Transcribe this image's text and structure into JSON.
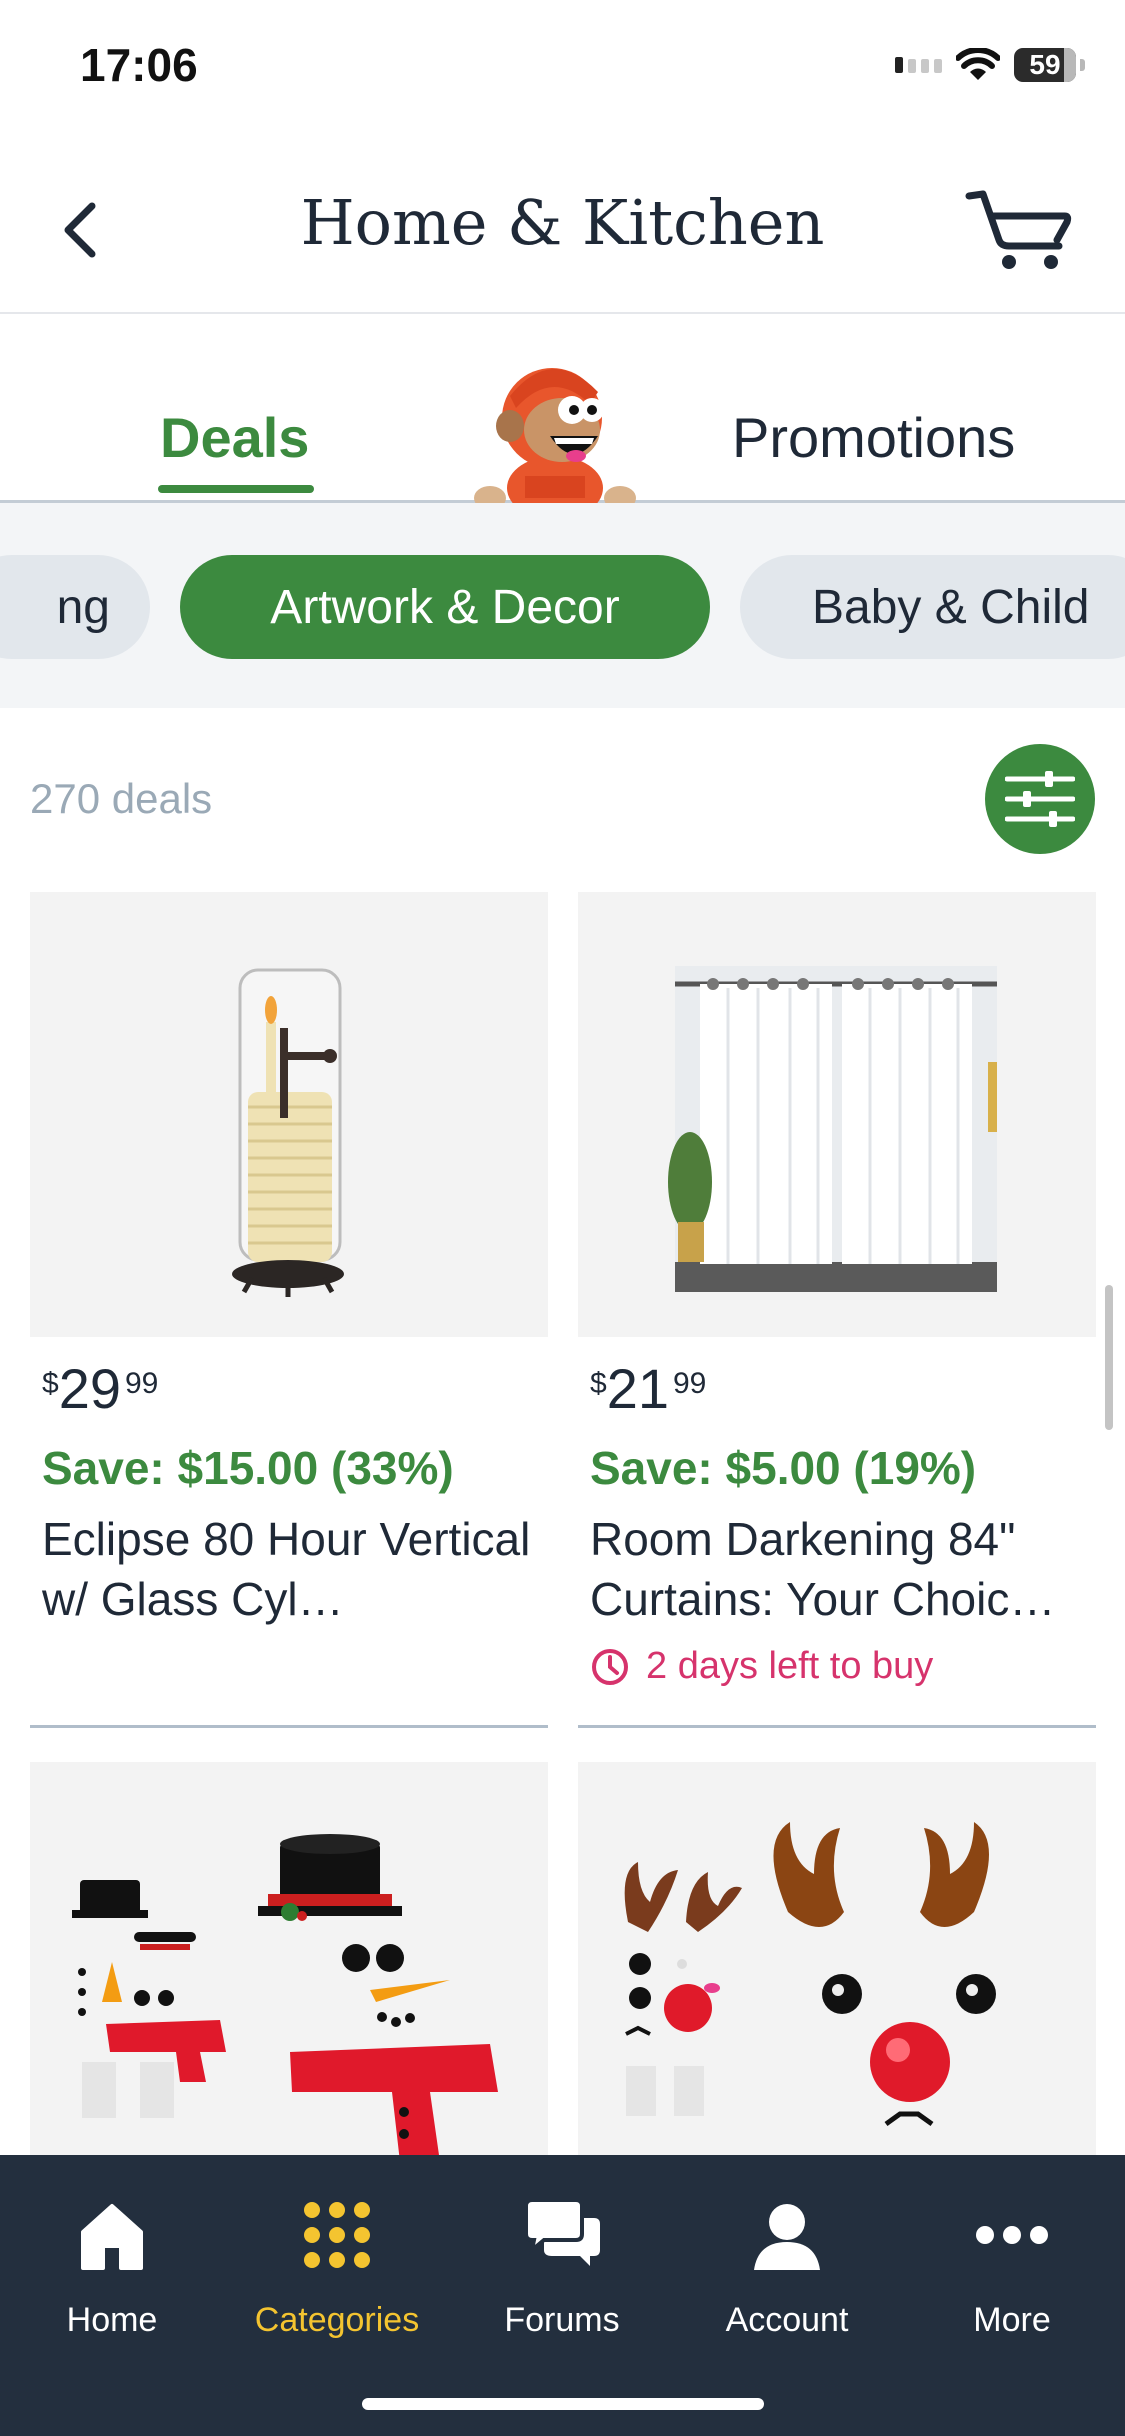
{
  "status": {
    "time": "17:06",
    "battery": "59"
  },
  "header": {
    "title": "Home & Kitchen"
  },
  "tabs": {
    "deals": "Deals",
    "promotions": "Promotions"
  },
  "chips": [
    {
      "label": "ng",
      "active": false
    },
    {
      "label": "Artwork & Decor",
      "active": true
    },
    {
      "label": "Baby & Child",
      "active": false
    }
  ],
  "deals_count": "270 deals",
  "products": [
    {
      "price_symbol": "$",
      "price_whole": "29",
      "price_cents": "99",
      "save": "Save: $15.00 (33%)",
      "title": "Eclipse 80 Hour Vertical w/ Glass Cyl…",
      "time_left": ""
    },
    {
      "price_symbol": "$",
      "price_whole": "21",
      "price_cents": "99",
      "save": "Save: $5.00 (19%)",
      "title": "Room Darkening 84\" Curtains: Your Choic…",
      "time_left": "2 days left to buy"
    }
  ],
  "bottom_nav": [
    {
      "label": "Home",
      "icon": "home-icon",
      "active": false
    },
    {
      "label": "Categories",
      "icon": "grid-icon",
      "active": true
    },
    {
      "label": "Forums",
      "icon": "chat-icon",
      "active": false
    },
    {
      "label": "Account",
      "icon": "person-icon",
      "active": false
    },
    {
      "label": "More",
      "icon": "more-icon",
      "active": false
    }
  ],
  "colors": {
    "accent": "#3c8a3f",
    "nav_bg": "#232f3e",
    "nav_active": "#f4c430",
    "timer": "#d6336c"
  }
}
